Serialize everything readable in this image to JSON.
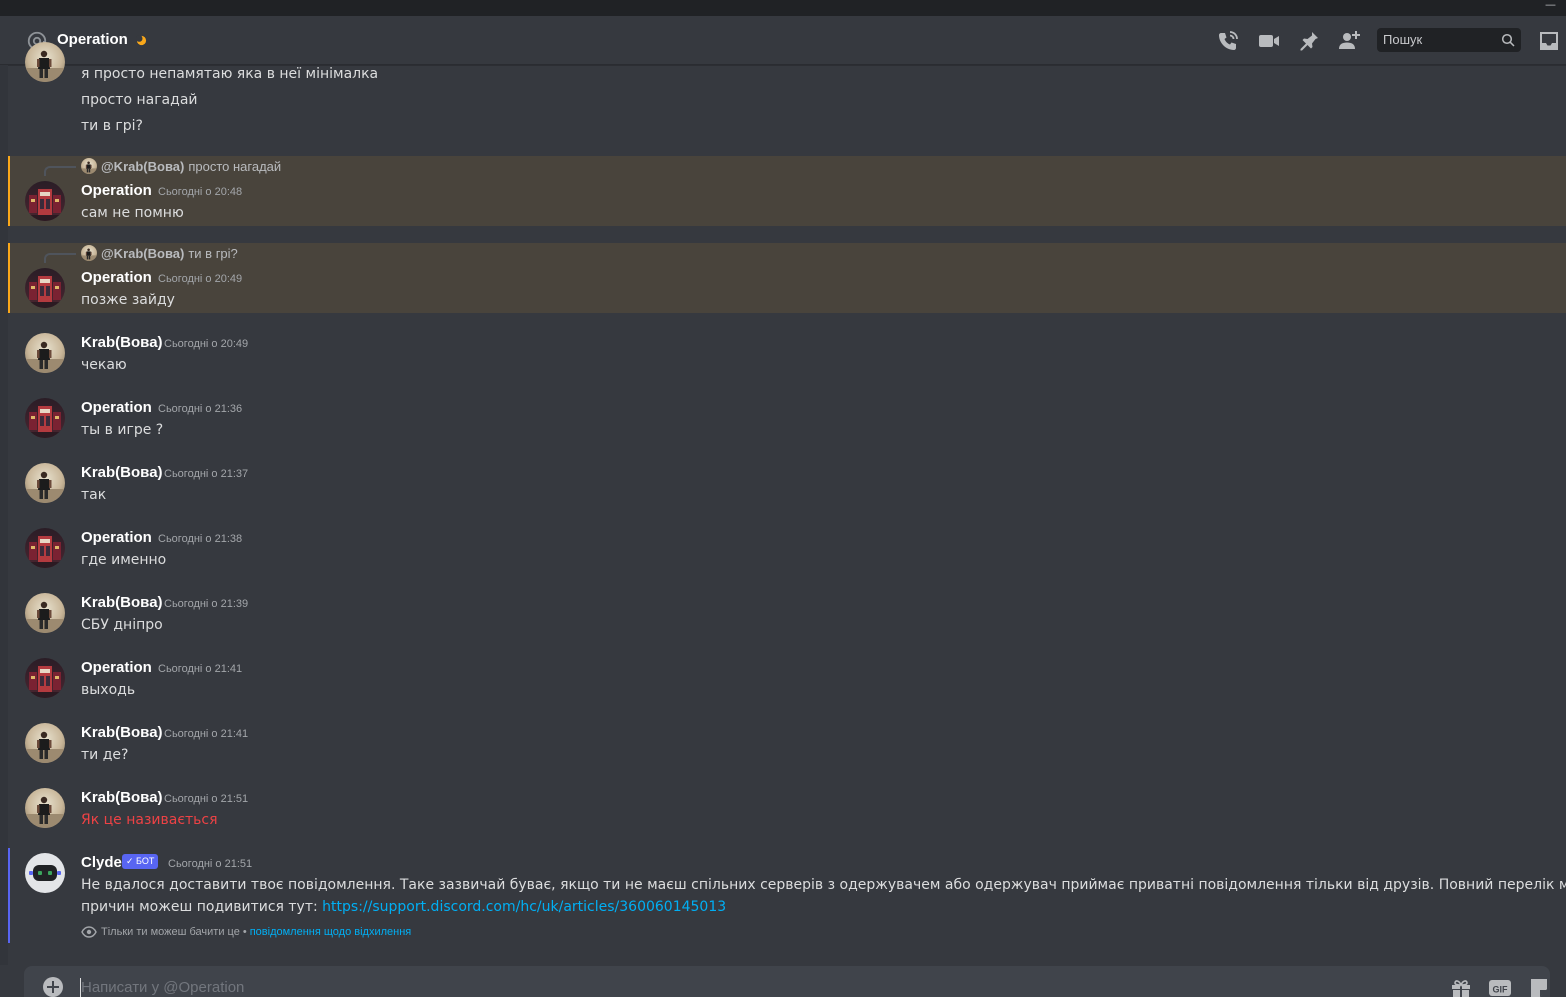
{
  "header": {
    "channel_name": "Operation",
    "search_placeholder": "Пошук"
  },
  "colors": {
    "background": "#36393f",
    "highlight": "#49443c",
    "highlight_bar": "#faa81a",
    "link": "#00aff4",
    "error_text": "#ed4245",
    "bot_badge": "#5865f2"
  },
  "icons": {
    "header": [
      "at-icon",
      "idle-moon-icon",
      "phone-call-icon",
      "video-call-icon",
      "pin-icon",
      "add-friend-icon",
      "search-icon",
      "inbox-icon"
    ],
    "composer": [
      "attach-plus-icon",
      "gift-icon",
      "gif-icon",
      "sticker-icon"
    ]
  },
  "messages": {
    "m0": {
      "lines": [
        "я просто непамятаю яка в неї мінімалка",
        "просто нагадай",
        "ти в грі?"
      ]
    },
    "m1": {
      "reply_author": "@Krab(Вова)",
      "reply_text": "просто нагадай",
      "author": "Operation",
      "time": "Сьогодні о 20:48",
      "text": "сам не помню"
    },
    "m2": {
      "reply_author": "@Krab(Вова)",
      "reply_text": "ти в грі?",
      "author": "Operation",
      "time": "Сьогодні о 20:49",
      "text": "позже зайду"
    },
    "m3": {
      "author": "Krab(Вова)",
      "time": "Сьогодні о 20:49",
      "text": "чекаю"
    },
    "m4": {
      "author": "Operation",
      "time": "Сьогодні о 21:36",
      "text": "ты в игре ?"
    },
    "m5": {
      "author": "Krab(Вова)",
      "time": "Сьогодні о 21:37",
      "text": "так"
    },
    "m6": {
      "author": "Operation",
      "time": "Сьогодні о 21:38",
      "text": "где именно"
    },
    "m7": {
      "author": "Krab(Вова)",
      "time": "Сьогодні о 21:39",
      "text": "СБУ дніпро"
    },
    "m8": {
      "author": "Operation",
      "time": "Сьогодні о 21:41",
      "text": "выходь"
    },
    "m9": {
      "author": "Krab(Вова)",
      "time": "Сьогодні о 21:41",
      "text": "ти де?"
    },
    "m10": {
      "author": "Krab(Вова)",
      "time": "Сьогодні о 21:51",
      "text": "Як це називається"
    },
    "clyde": {
      "author": "Clyde",
      "badge": "✓ БОТ",
      "time": "Сьогодні о 21:51",
      "text_line1": "Не вдалося доставити твоє повідомлення. Таке зазвичай буває, якщо ти не маєш спільних серверів з одержувачем або одержувач приймає приватні повідомлення тільки від друзів. Повний перелік можливих",
      "text_line2_prefix": "причин можеш подивитися тут: ",
      "link": "https://support.discord.com/hc/uk/articles/360060145013",
      "ephemeral_note": "Тільки ти можеш бачити це •",
      "ephemeral_link": "повідомлення щодо відхилення"
    }
  },
  "composer": {
    "placeholder": "Написати у @Operation",
    "gif_label": "GIF"
  },
  "titlebar": {
    "minimize": "—"
  }
}
